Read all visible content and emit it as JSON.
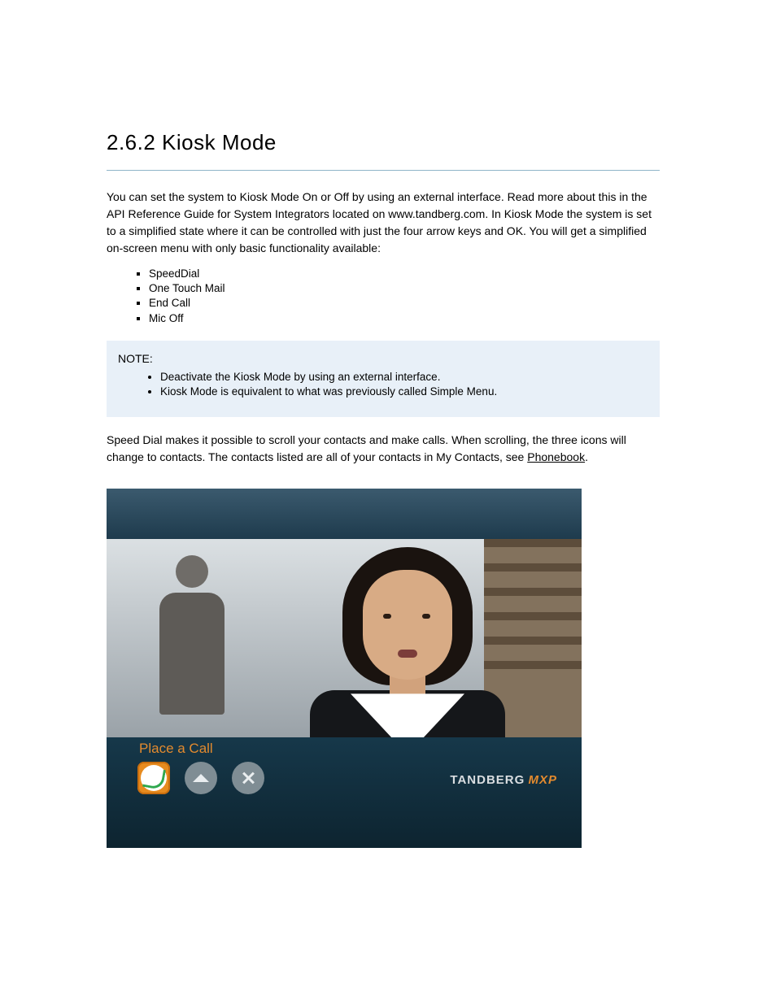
{
  "heading": "2.6.2 Kiosk Mode",
  "intro": "You can set the system to Kiosk Mode On or Off by using an external interface. Read more about this in the API Reference Guide for System Integrators located on www.tandberg.com. In Kiosk Mode the system is set to a simplified state where it can be controlled with just the four arrow keys and OK. You will get a simplified on-screen menu with only basic functionality available:",
  "menu_items": [
    "SpeedDial",
    "One Touch Mail",
    "End Call",
    "Mic Off"
  ],
  "note_title": "NOTE:",
  "note_items": [
    "Deactivate the Kiosk Mode by using an external interface.",
    "Kiosk Mode is equivalent to what was previously called Simple Menu."
  ],
  "followup": "Speed Dial makes it possible to scroll your contacts and make calls. When scrolling, the three icons will change to contacts. The contacts listed are all of your contacts in My Contacts, see",
  "followup_link": "Phonebook",
  "followup_tail": ".",
  "place_a_call": "Place a Call",
  "brand_name": "TANDBERG",
  "brand_model": "MXP"
}
